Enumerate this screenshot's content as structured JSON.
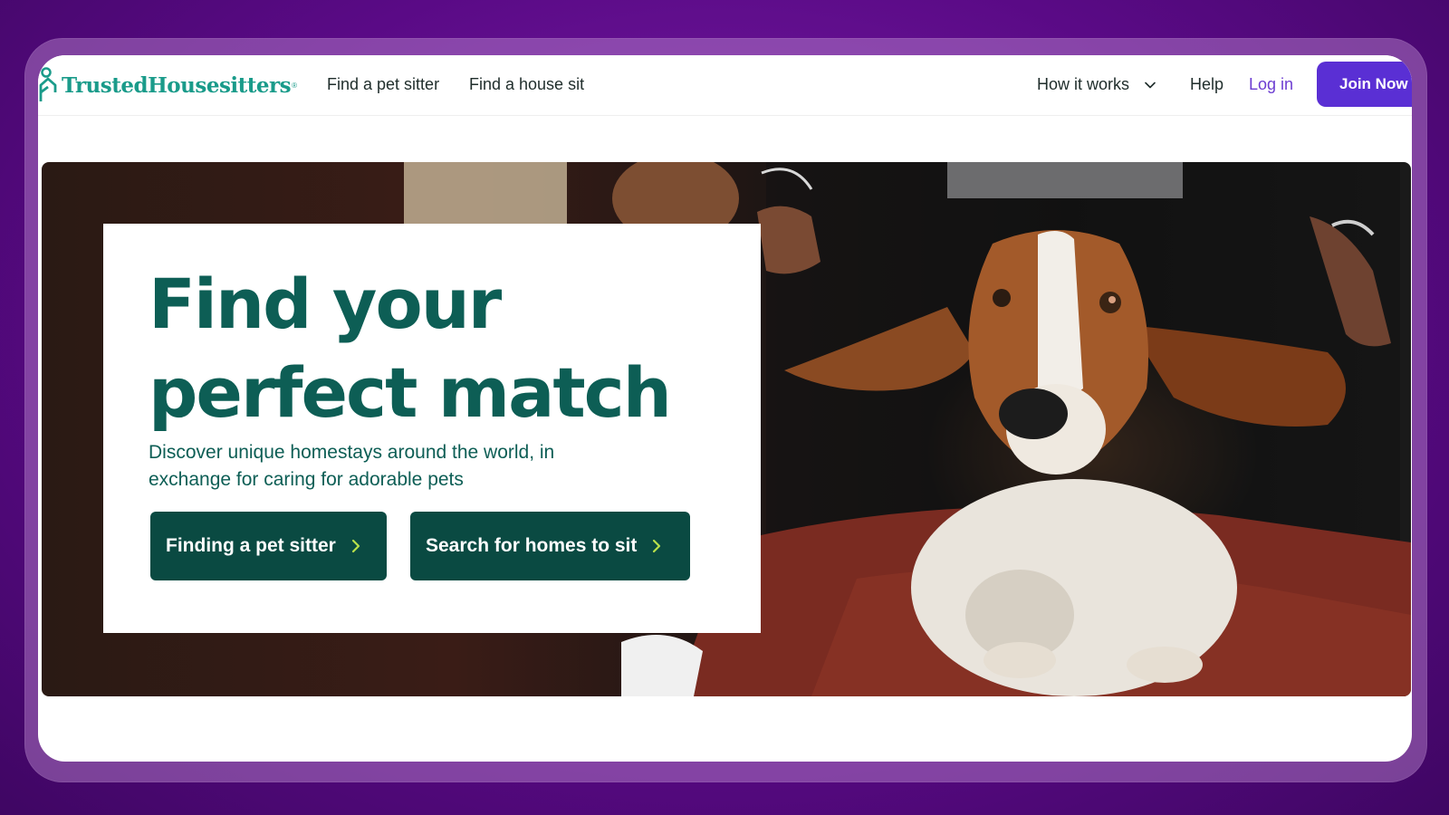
{
  "brand": {
    "name": "TrustedHousesitters",
    "tm": "®",
    "color": "#1a9b8a"
  },
  "nav": {
    "find_pet_sitter": "Find a pet sitter",
    "find_house_sit": "Find a house sit",
    "how_it_works": "How it works",
    "help": "Help",
    "login": "Log in",
    "join": "Join Now"
  },
  "hero": {
    "headline_line1": "Find your",
    "headline_line2": "perfect match",
    "subtitle": "Discover unique homestays around the world, in exchange for caring for adorable pets",
    "cta_primary": "Finding a pet sitter",
    "cta_secondary": "Search for homes to sit",
    "image": "basset-hound-ears-held-up"
  },
  "colors": {
    "accent_purple": "#5a2fd4",
    "login_purple": "#6c3dd1",
    "headline_green": "#0d5e55",
    "cta_green": "#0a4a42",
    "arrow_lime": "#b8e04a"
  }
}
